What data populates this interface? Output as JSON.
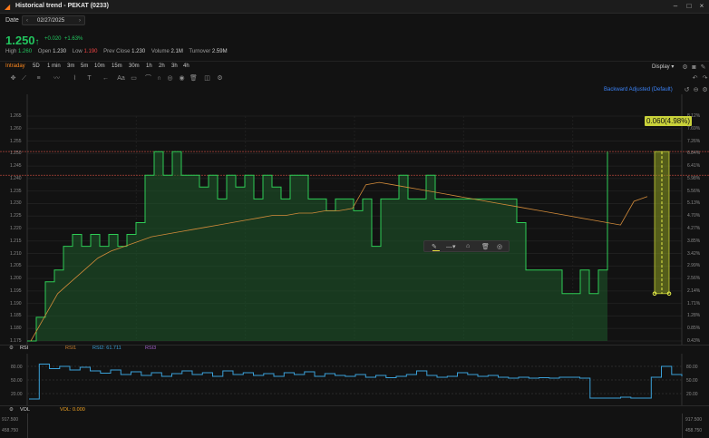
{
  "window": {
    "title": "Historical trend - PEKAT  (0233)",
    "buttons": [
      "minimize-icon",
      "maximize-icon",
      "close-icon"
    ]
  },
  "date": {
    "label": "Date",
    "value": "02/27/2025"
  },
  "quote": {
    "price": "1.250",
    "change": "+0.020",
    "change_pct": "+1.63%",
    "high_label": "High",
    "high": "1.260",
    "open_label": "Open",
    "open": "1.230",
    "low_label": "Low",
    "low": "1.190",
    "prev_close_label": "Prev Close",
    "prev_close": "1.230",
    "volume_label": "Volume",
    "volume": "2.1M",
    "turnover_label": "Turnover",
    "turnover": "2.59M"
  },
  "tabs": [
    "Intraday",
    "5D",
    "1 min",
    "3m",
    "5m",
    "10m",
    "15m",
    "30m",
    "1h",
    "2h",
    "3h",
    "4h"
  ],
  "active_tab": "Intraday",
  "display_label": "Display",
  "adjust_label": "Backward Adjusted (Default)",
  "toolbar_icons": [
    "crosshair-icon",
    "line-icon",
    "fib-icon",
    "trend-icon",
    "pattern-icon",
    "text-icon",
    "measure-icon",
    "brush-icon",
    "arrow-icon",
    "text-aa-icon",
    "note-icon",
    "lock-icon",
    "magnet-icon",
    "eye-icon",
    "trash-icon",
    "layers-icon",
    "settings-icon"
  ],
  "price_axis_left": [
    "1.265",
    "1.260",
    "1.255",
    "1.250",
    "1.245",
    "1.240",
    "1.235",
    "1.230",
    "1.225",
    "1.220",
    "1.215",
    "1.210",
    "1.205",
    "1.200",
    "1.195",
    "1.190",
    "1.185",
    "1.180",
    "1.175"
  ],
  "price_axis_right": [
    "8.12%",
    "7.69%",
    "7.26%",
    "6.84%",
    "6.41%",
    "5.98%",
    "5.56%",
    "5.13%",
    "4.70%",
    "4.27%",
    "3.85%",
    "3.42%",
    "2.99%",
    "2.56%",
    "2.14%",
    "1.71%",
    "1.28%",
    "0.85%",
    "0.43%"
  ],
  "tooltip": "0.060(4.98%)",
  "rsi": {
    "label": "RSI",
    "rsi1": "RSI1",
    "rsi2": "RSI2: 61.711",
    "rsi3": "RSI3",
    "levels": [
      "80.00",
      "50.00",
      "20.00"
    ]
  },
  "vol": {
    "label": "VOL",
    "value": "VOL: 0.000",
    "levels": [
      "917.500",
      "458.750"
    ]
  },
  "chart_data": {
    "type": "line",
    "series": [
      {
        "values": [
          1.17,
          1.18,
          1.195,
          1.2,
          1.21,
          1.215,
          1.21,
          1.215,
          1.21,
          1.215,
          1.21,
          1.215,
          1.22,
          1.24,
          1.25,
          1.24,
          1.25,
          1.24,
          1.24,
          1.235,
          1.24,
          1.23,
          1.24,
          1.235,
          1.24,
          1.23,
          1.24,
          1.235,
          1.23,
          1.24,
          1.24,
          1.23,
          1.23,
          1.225,
          1.23,
          1.23,
          1.225,
          1.23,
          1.21,
          1.23,
          1.23,
          1.24,
          1.23,
          1.23,
          1.24,
          1.23,
          1.23,
          1.23,
          1.23,
          1.23,
          1.23,
          1.23,
          1.23,
          1.23,
          1.22,
          1.2,
          1.2,
          1.2,
          1.2,
          1.19,
          1.19,
          1.2,
          1.19,
          1.2,
          1.25
        ]
      },
      {
        "values": [
          1.17,
          1.18,
          1.19,
          1.195,
          1.2,
          1.205,
          1.208,
          1.21,
          1.212,
          1.214,
          1.215,
          1.216,
          1.217,
          1.218,
          1.219,
          1.22,
          1.221,
          1.222,
          1.223,
          1.223,
          1.224,
          1.224,
          1.225,
          1.225,
          1.226,
          1.236,
          1.237,
          1.236,
          1.235,
          1.234,
          1.233,
          1.232,
          1.231,
          1.23,
          1.229,
          1.228,
          1.227,
          1.226,
          1.225,
          1.224,
          1.223,
          1.222,
          1.221,
          1.22,
          1.219,
          1.229,
          1.231
        ]
      }
    ],
    "ylim": [
      1.17,
      1.265
    ],
    "reference_lines": [
      1.25,
      1.24
    ]
  }
}
